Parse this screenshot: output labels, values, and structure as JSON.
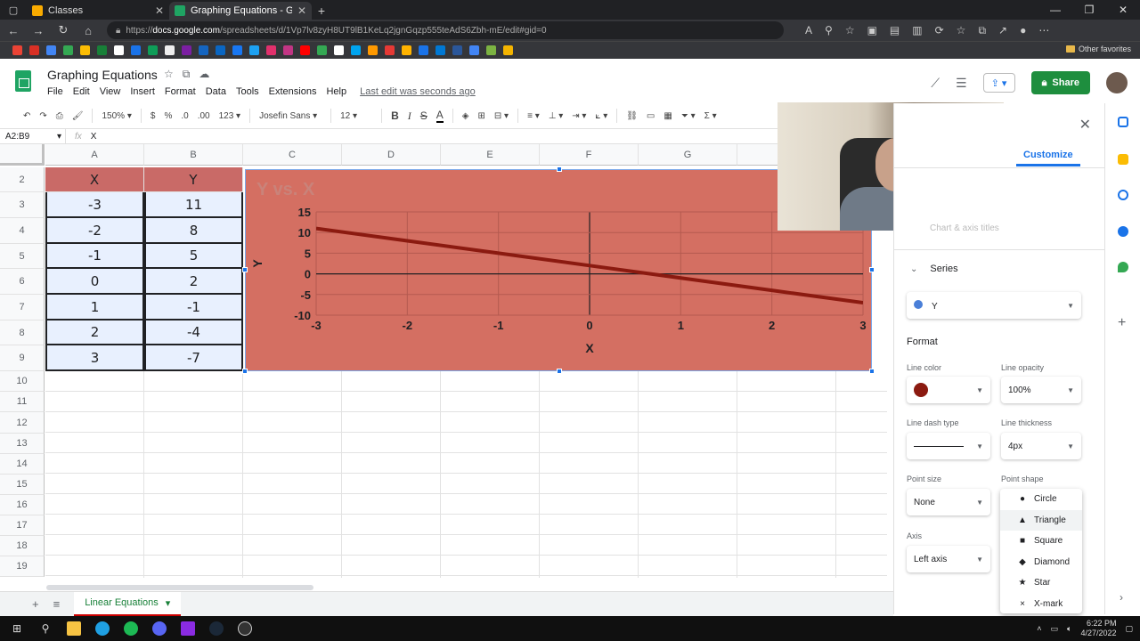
{
  "browser": {
    "tabs": [
      {
        "title": "Classes",
        "color": "#f9ab00",
        "active": false
      },
      {
        "title": "Graphing Equations - Google Sh",
        "color": "#1fa463",
        "active": true
      }
    ],
    "url_domain": "docs.google.com",
    "url_prefix": "https://",
    "url_path": "/spreadsheets/d/1Vp7lv8zyH8UT9lB1KeLq2jgnGqzp555teAdS6Zbh-mE/edit#gid=0",
    "other_favorites": "Other favorites"
  },
  "doc": {
    "title": "Graphing Equations",
    "menu": [
      "File",
      "Edit",
      "View",
      "Insert",
      "Format",
      "Data",
      "Tools",
      "Extensions",
      "Help"
    ],
    "last_edit": "Last edit was seconds ago",
    "share_label": "Share"
  },
  "toolbar": {
    "zoom": "150%",
    "currency": "$",
    "percent": "%",
    "dec_less": ".0",
    "dec_more": ".00",
    "format_num": "123",
    "font": "Josefin Sans",
    "font_size": "12",
    "bold": "B",
    "italic": "I",
    "strike": "S",
    "font_color": "A"
  },
  "formula_bar": {
    "range": "A2:B9",
    "fx": "fx",
    "value": "X"
  },
  "grid": {
    "columns": [
      "A",
      "B",
      "C",
      "D",
      "E",
      "F",
      "G"
    ],
    "rows": [
      "2",
      "3",
      "4",
      "5",
      "6",
      "7",
      "8",
      "9",
      "10",
      "11",
      "12",
      "13",
      "14",
      "15",
      "16",
      "17",
      "18",
      "19"
    ],
    "header": [
      "X",
      "Y"
    ],
    "data": [
      [
        "-3",
        "11"
      ],
      [
        "-2",
        "8"
      ],
      [
        "-1",
        "5"
      ],
      [
        "0",
        "2"
      ],
      [
        "1",
        "-1"
      ],
      [
        "2",
        "-4"
      ],
      [
        "3",
        "-7"
      ]
    ]
  },
  "chart_data": {
    "type": "line",
    "title": "Y vs. X",
    "xlabel": "X",
    "ylabel": "Y",
    "x": [
      -3,
      -2,
      -1,
      0,
      1,
      2,
      3
    ],
    "series": [
      {
        "name": "Y",
        "values": [
          11,
          8,
          5,
          2,
          -1,
          -4,
          -7
        ]
      }
    ],
    "xlim": [
      -3,
      3
    ],
    "ylim": [
      -10,
      15
    ],
    "xticks": [
      "-3",
      "-2",
      "-1",
      "0",
      "1",
      "2",
      "3"
    ],
    "yticks": [
      "15",
      "10",
      "5",
      "0",
      "-5",
      "-10"
    ],
    "grid": true,
    "background": "#d46f62",
    "line_color": "#8b1a10"
  },
  "editor": {
    "tab": "Customize",
    "faded_item": "Chart & axis titles",
    "series_section": "Series",
    "series_selected": "Y",
    "series_dot_color": "#4a7fd8",
    "format": "Format",
    "line_color_label": "Line color",
    "line_color_value": "#8b1a10",
    "line_opacity_label": "Line opacity",
    "line_opacity": "100%",
    "dash_label": "Line dash type",
    "thickness_label": "Line thickness",
    "thickness": "4px",
    "point_size_label": "Point size",
    "point_size": "None",
    "point_shape_label": "Point shape",
    "axis_label": "Axis",
    "axis": "Left axis",
    "shapes": [
      {
        "sym": "●",
        "label": "Circle"
      },
      {
        "sym": "▲",
        "label": "Triangle"
      },
      {
        "sym": "■",
        "label": "Square"
      },
      {
        "sym": "◆",
        "label": "Diamond"
      },
      {
        "sym": "★",
        "label": "Star"
      },
      {
        "sym": "×",
        "label": "X-mark"
      }
    ]
  },
  "sheet_tab": "Linear Equations",
  "taskbar": {
    "time": "6:22 PM",
    "date": "4/27/2022"
  }
}
